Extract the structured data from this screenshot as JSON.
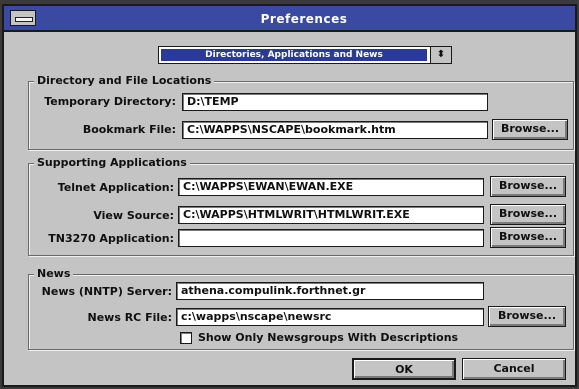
{
  "window": {
    "title": "Preferences"
  },
  "category": {
    "selected": "Directories, Applications and News",
    "arrow": "⬍"
  },
  "directory_group": {
    "legend": "Directory and File Locations",
    "temp_label": "Temporary Directory:",
    "temp_value": "D:\\TEMP",
    "bookmark_label": "Bookmark File:",
    "bookmark_value": "C:\\WAPPS\\NSCAPE\\bookmark.htm",
    "browse_label": "Browse..."
  },
  "apps_group": {
    "legend": "Supporting Applications",
    "telnet_label": "Telnet Application:",
    "telnet_value": "C:\\WAPPS\\EWAN\\EWAN.EXE",
    "viewsource_label": "View Source:",
    "viewsource_value": "C:\\WAPPS\\HTMLWRIT\\HTMLWRIT.EXE",
    "tn3270_label": "TN3270 Application:",
    "tn3270_value": "",
    "browse_label": "Browse..."
  },
  "news_group": {
    "legend": "News",
    "server_label": "News (NNTP) Server:",
    "server_value": "athena.compulink.forthnet.gr",
    "rc_label": "News RC File:",
    "rc_value": "c:\\wapps\\nscape\\newsrc",
    "browse_label": "Browse...",
    "checkbox_label": "Show Only Newsgroups With Descriptions",
    "checkbox_checked": false
  },
  "buttons": {
    "ok": "OK",
    "cancel": "Cancel"
  }
}
